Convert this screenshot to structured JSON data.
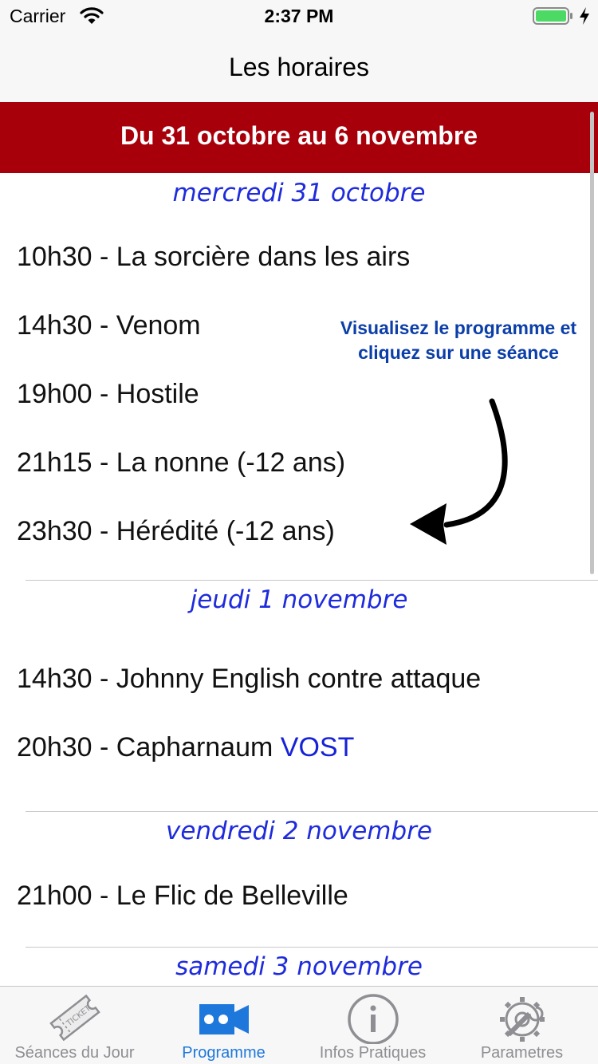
{
  "status_bar": {
    "carrier": "Carrier",
    "time": "2:37 PM"
  },
  "nav": {
    "title": "Les horaires"
  },
  "banner": {
    "text": "Du 31 octobre au 6 novembre"
  },
  "days": [
    {
      "label": "mercredi 31 octobre",
      "sessions": [
        {
          "text": "10h30 - La sorcière dans les airs"
        },
        {
          "text": "14h30 - Venom"
        },
        {
          "text": "19h00 - Hostile"
        },
        {
          "text": "21h15 - La nonne  (-12 ans)"
        },
        {
          "text": "23h30 - Hérédité  (-12 ans)"
        }
      ]
    },
    {
      "label": "jeudi 1 novembre",
      "sessions": [
        {
          "text": "14h30 - Johnny English contre attaque"
        },
        {
          "text": "20h30 - Capharnaum ",
          "tag": "VOST"
        }
      ]
    },
    {
      "label": "vendredi 2 novembre",
      "sessions": [
        {
          "text": "21h00 - Le Flic de Belleville"
        }
      ]
    },
    {
      "label": "samedi 3 novembre",
      "sessions": []
    }
  ],
  "annotation": {
    "text": "Visualisez le programme et cliquez sur une séance"
  },
  "tabs": [
    {
      "label": "Séances du Jour",
      "icon": "ticket-icon",
      "active": false
    },
    {
      "label": "Programme",
      "icon": "video-camera-icon",
      "active": true
    },
    {
      "label": "Infos Pratiques",
      "icon": "info-icon",
      "active": false
    },
    {
      "label": "Parametres",
      "icon": "gear-wrench-icon",
      "active": false
    }
  ],
  "colors": {
    "banner": "#a8000a",
    "day_header": "#1e2bdc",
    "vost": "#1522d8",
    "tab_active": "#1e78dc",
    "tab_inactive": "#8e8e93"
  }
}
